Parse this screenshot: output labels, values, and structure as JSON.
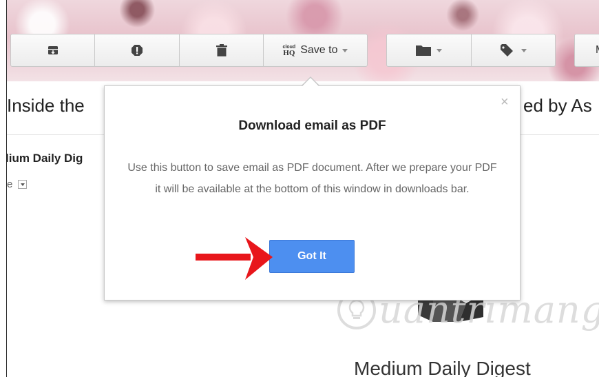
{
  "toolbar": {
    "archive_icon": "archive-icon",
    "spam_icon": "report-spam-icon",
    "delete_icon": "trash-icon",
    "save_to": {
      "logo_line1": "cloud",
      "logo_line2": "HQ",
      "label": "Save to"
    },
    "move_icon": "folder-icon",
    "labels_icon": "tag-icon",
    "more_initial": "M"
  },
  "email": {
    "subject_visible": "Inside the",
    "subject_tail_visible": "ed by As",
    "sender_visible": "lium Daily Dig",
    "to_visible": "e",
    "body_title": "Medium Daily Digest"
  },
  "popup": {
    "title": "Download email as PDF",
    "body": "Use this button to save email as PDF document. After we prepare your PDF it will be available at the bottom of this window in downloads bar.",
    "button_label": "Got It",
    "close_symbol": "×"
  },
  "watermark": {
    "text": "uantrimang"
  },
  "colors": {
    "accent_button": "#4d8ff0",
    "arrow": "#e8161b"
  }
}
